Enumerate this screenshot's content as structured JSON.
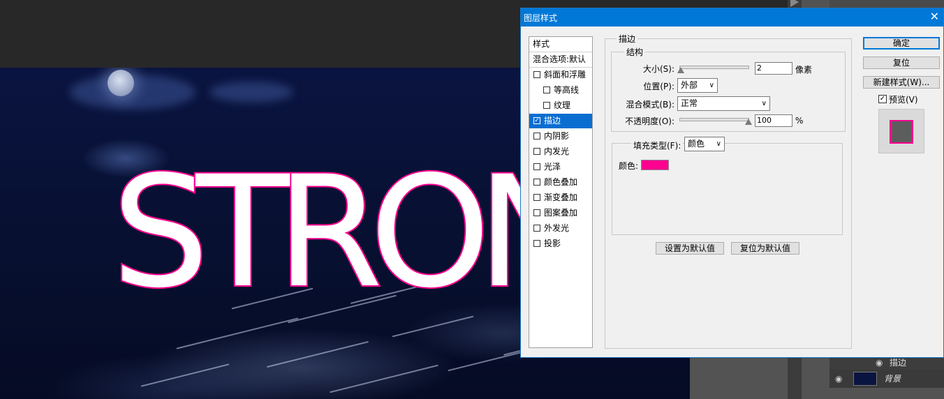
{
  "canvas": {
    "artwork_text": "STRON"
  },
  "layers": {
    "effect_label": "描边",
    "background_label": "背景"
  },
  "dialog": {
    "title": "图层样式",
    "styles_header": "样式",
    "blend_options": "混合选项:默认",
    "items": [
      {
        "label": "斜面和浮雕",
        "checked": false
      },
      {
        "label": "等高线",
        "checked": false
      },
      {
        "label": "纹理",
        "checked": false
      },
      {
        "label": "描边",
        "checked": true
      },
      {
        "label": "内阴影",
        "checked": false
      },
      {
        "label": "内发光",
        "checked": false
      },
      {
        "label": "光泽",
        "checked": false
      },
      {
        "label": "颜色叠加",
        "checked": false
      },
      {
        "label": "渐变叠加",
        "checked": false
      },
      {
        "label": "图案叠加",
        "checked": false
      },
      {
        "label": "外发光",
        "checked": false
      },
      {
        "label": "投影",
        "checked": false
      }
    ],
    "stroke": {
      "section_title": "描边",
      "structure_title": "结构",
      "size_label": "大小(S):",
      "size_value": "2",
      "size_unit": "像素",
      "position_label": "位置(P):",
      "position_value": "外部",
      "blend_label": "混合模式(B):",
      "blend_value": "正常",
      "opacity_label": "不透明度(O):",
      "opacity_value": "100",
      "opacity_unit": "%",
      "fill_type_label": "填充类型(F):",
      "fill_type_value": "颜色",
      "color_label": "颜色:",
      "color_hex": "#ff0090",
      "set_default": "设置为默认值",
      "reset_default": "复位为默认值"
    },
    "buttons": {
      "ok": "确定",
      "reset": "复位",
      "new_style": "新建样式(W)...",
      "preview": "预览(V)",
      "preview_checked": true
    }
  }
}
